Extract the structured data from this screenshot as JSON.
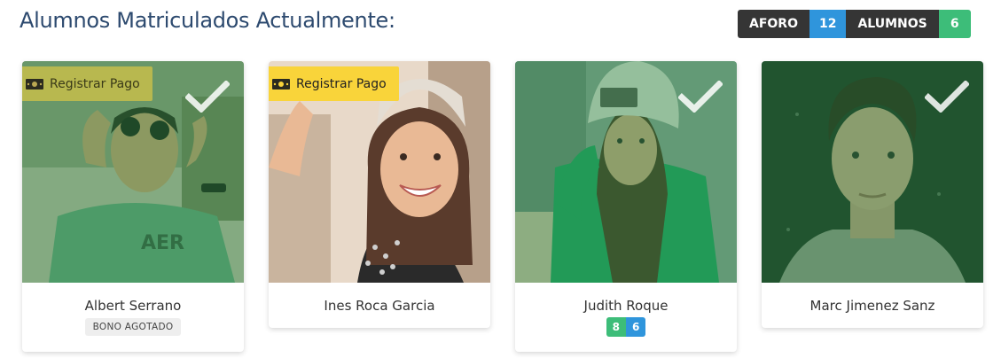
{
  "header": {
    "title": "Alumnos Matriculados Actualmente:",
    "aforo_label": "AFORO",
    "aforo_value": "12",
    "alumnos_label": "ALUMNOS",
    "alumnos_value": "6"
  },
  "students": [
    {
      "name": "Albert Serrano",
      "pay_label": "Registrar Pago",
      "status": "BONO AGOTADO",
      "selected": true
    },
    {
      "name": "Ines Roca Garcia",
      "pay_label": "Registrar Pago",
      "selected": false
    },
    {
      "name": "Judith Roque",
      "sessions_used": "8",
      "sessions_total": "6",
      "selected": true
    },
    {
      "name": "Marc Jimenez Sanz",
      "selected": true
    }
  ],
  "colors": {
    "title": "#2d4a6f",
    "blue": "#2f95dc",
    "green": "#3dbd79",
    "dark": "#353535",
    "pay": "#f9d43a",
    "selected_overlay": "#268a3c"
  },
  "icons": [
    "check-icon",
    "money-bill-icon"
  ]
}
